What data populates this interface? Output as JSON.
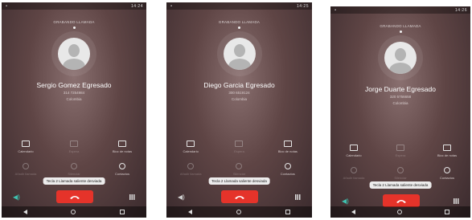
{
  "phones": [
    {
      "status_time": "14:24",
      "recording_label": "GRABANDO LLAMADA",
      "contact_name": "Sergio Gomez Egresado",
      "contact_number": "314 7254984",
      "contact_country": "Colombia",
      "controls_row1": [
        "Calendario",
        "Espera",
        "Bloc de notas"
      ],
      "controls_row2": [
        "Añadir llamada",
        "Silenciar",
        "Contactos"
      ],
      "toast": "Tecla 2 Llamada saliente desviada",
      "icons": [
        "speaker-icon",
        "end-call-icon",
        "keypad-icon"
      ]
    },
    {
      "status_time": "14:25",
      "recording_label": "GRABANDO LLAMADA",
      "contact_name": "Diego Garcia Egresado",
      "contact_number": "300 6519124",
      "contact_country": "Colombia",
      "controls_row1": [
        "Calendario",
        "Espera",
        "Bloc de notas"
      ],
      "controls_row2": [
        "Añadir llamada",
        "Silenciar",
        "Contactos"
      ],
      "toast": "Tecla 2 Llamada saliente desviada",
      "icons": [
        "speaker-icon",
        "end-call-icon",
        "keypad-icon"
      ]
    },
    {
      "status_time": "14:26",
      "recording_label": "GRABANDO LLAMADA",
      "contact_name": "Jorge Duarte Egresado",
      "contact_number": "320 5756658",
      "contact_country": "Colombia",
      "controls_row1": [
        "Calendario",
        "Espera",
        "Bloc de notas"
      ],
      "controls_row2": [
        "Añadir llamada",
        "Silenciar",
        "Contactos"
      ],
      "toast": "Tecla 2 Llamada saliente desviada",
      "icons": [
        "speaker-icon",
        "end-call-icon",
        "keypad-icon"
      ]
    }
  ],
  "colors": {
    "end_call": "#e5332a",
    "speaker_active": "#3fc1b0"
  }
}
